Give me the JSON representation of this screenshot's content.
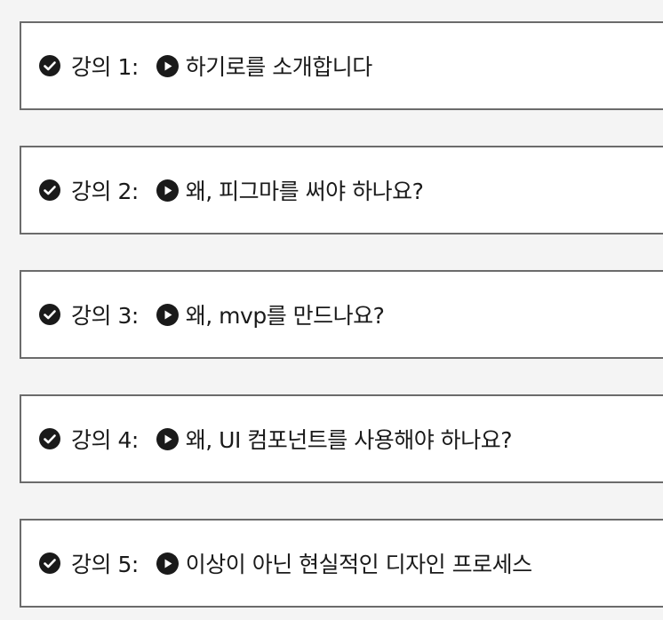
{
  "lectures": [
    {
      "label": "강의 1:",
      "title": "하기로를 소개합니다"
    },
    {
      "label": "강의 2:",
      "title": "왜, 피그마를 써야 하나요?"
    },
    {
      "label": "강의 3:",
      "title": "왜, mvp를 만드나요?"
    },
    {
      "label": "강의 4:",
      "title": "왜, UI 컴포넌트를 사용해야 하나요?"
    },
    {
      "label": "강의 5:",
      "title": "이상이 아닌 현실적인 디자인 프로세스"
    }
  ],
  "icons": {
    "completed": "check-circle-icon",
    "play": "play-circle-icon"
  },
  "colors": {
    "icon": "#1a1a1a",
    "border": "#6b6b6b",
    "card_background": "#ffffff",
    "page_background": "#f4f4f4"
  }
}
